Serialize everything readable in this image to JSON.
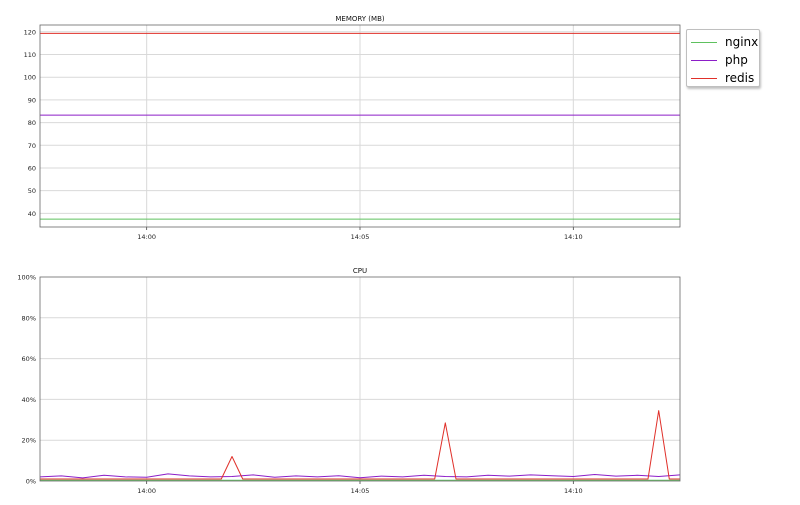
{
  "legend": {
    "items": [
      {
        "label": "nginx",
        "color": "#5ec15e"
      },
      {
        "label": "php",
        "color": "#8c1ec8"
      },
      {
        "label": "redis",
        "color": "#e0302a"
      }
    ]
  },
  "chart_data": [
    {
      "type": "line",
      "title": "MEMORY (MB)",
      "xlabel": "",
      "ylabel": "",
      "x_ticks": [
        "14:00",
        "14:05",
        "14:10"
      ],
      "xlim": [
        "13:57:30",
        "14:12:30"
      ],
      "ylim": [
        34,
        123
      ],
      "y_ticks": [
        40,
        50,
        60,
        70,
        80,
        90,
        100,
        110,
        120
      ],
      "y_tick_labels": [
        "40",
        "50",
        "60",
        "70",
        "80",
        "90",
        "100",
        "110",
        "120"
      ],
      "grid": true,
      "series": [
        {
          "name": "nginx",
          "color": "#5ec15e",
          "x": [
            "13:57:30",
            "14:12:30"
          ],
          "values": [
            37.5,
            37.5
          ]
        },
        {
          "name": "php",
          "color": "#8c1ec8",
          "x": [
            "13:57:30",
            "14:12:30"
          ],
          "values": [
            83.3,
            83.3
          ]
        },
        {
          "name": "redis",
          "color": "#e0302a",
          "x": [
            "13:57:30",
            "14:12:30"
          ],
          "values": [
            119.3,
            119.3
          ]
        }
      ]
    },
    {
      "type": "line",
      "title": "CPU",
      "xlabel": "",
      "ylabel": "",
      "x_ticks": [
        "14:00",
        "14:05",
        "14:10"
      ],
      "xlim": [
        "13:57:30",
        "14:12:30"
      ],
      "ylim": [
        0,
        100
      ],
      "y_ticks": [
        0,
        20,
        40,
        60,
        80,
        100
      ],
      "y_tick_labels": [
        "0%",
        "20%",
        "40%",
        "60%",
        "80%",
        "100%"
      ],
      "grid": true,
      "series": [
        {
          "name": "nginx",
          "color": "#5ec15e",
          "x": [
            "13:57:30",
            "14:12:30"
          ],
          "values": [
            0.4,
            0.4
          ]
        },
        {
          "name": "php",
          "color": "#8c1ec8",
          "x": [
            "13:57:30",
            "13:58:00",
            "13:58:30",
            "13:59:00",
            "13:59:30",
            "14:00:00",
            "14:00:30",
            "14:01:00",
            "14:01:30",
            "14:02:00",
            "14:02:30",
            "14:03:00",
            "14:03:30",
            "14:04:00",
            "14:04:30",
            "14:05:00",
            "14:05:30",
            "14:06:00",
            "14:06:30",
            "14:07:00",
            "14:07:30",
            "14:08:00",
            "14:08:30",
            "14:09:00",
            "14:09:30",
            "14:10:00",
            "14:10:30",
            "14:11:00",
            "14:11:30",
            "14:12:00",
            "14:12:30"
          ],
          "values": [
            2.0,
            2.5,
            1.5,
            2.8,
            2.0,
            1.8,
            3.5,
            2.5,
            2.0,
            2.2,
            3.0,
            1.8,
            2.5,
            2.0,
            2.6,
            1.6,
            2.4,
            2.0,
            2.8,
            2.2,
            2.0,
            2.8,
            2.4,
            3.0,
            2.6,
            2.2,
            3.2,
            2.4,
            2.8,
            2.2,
            3.0
          ]
        },
        {
          "name": "redis",
          "color": "#e0302a",
          "x": [
            "13:57:30",
            "14:01:45",
            "14:02:00",
            "14:02:15",
            "14:06:45",
            "14:07:00",
            "14:07:15",
            "14:11:45",
            "14:12:00",
            "14:12:15",
            "14:12:30"
          ],
          "values": [
            1.0,
            1.0,
            12.0,
            1.0,
            1.0,
            28.5,
            1.0,
            1.0,
            34.5,
            1.0,
            1.0
          ]
        }
      ]
    }
  ]
}
